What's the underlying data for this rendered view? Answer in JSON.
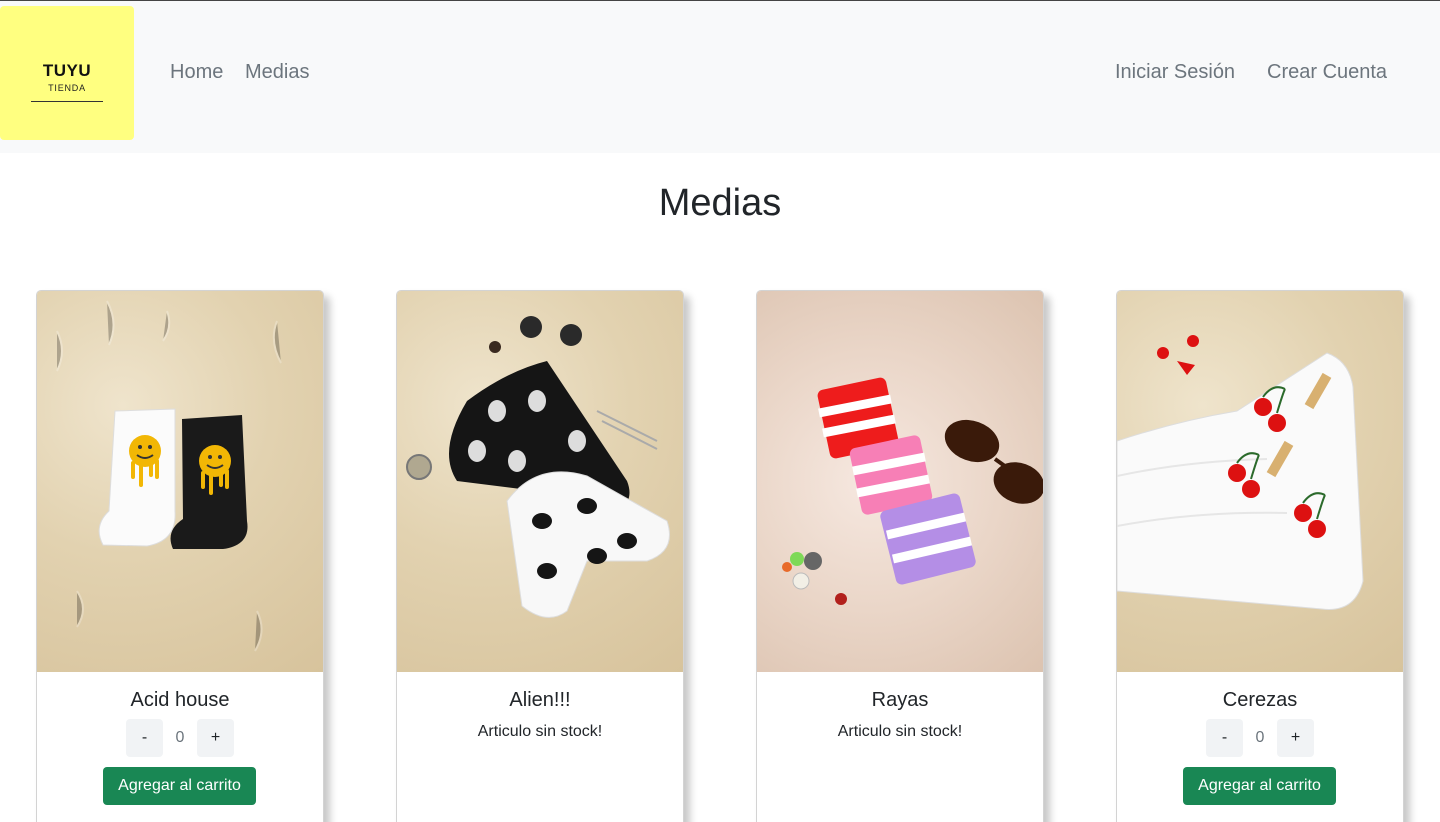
{
  "brand": {
    "name": "TUYU",
    "tagline": "TIENDA",
    "bg_color": "#ffff80"
  },
  "nav": {
    "left": [
      {
        "label": "Home"
      },
      {
        "label": "Medias"
      }
    ],
    "right": [
      {
        "label": "Iniciar Sesión"
      },
      {
        "label": "Crear Cuenta"
      }
    ]
  },
  "page": {
    "title": "Medias"
  },
  "colors": {
    "success": "#198754",
    "navbar_bg": "#f8f9fa",
    "muted": "#6c757d"
  },
  "products": [
    {
      "name": "Acid house",
      "in_stock": true,
      "quantity": "0",
      "minus_label": "-",
      "plus_label": "+",
      "add_label": "Agregar al carrito",
      "image": "white and black socks with melting smiley faces"
    },
    {
      "name": "Alien!!!",
      "in_stock": false,
      "stock_message": "Articulo sin stock!",
      "image": "black and white socks with alien heads"
    },
    {
      "name": "Rayas",
      "in_stock": false,
      "stock_message": "Articulo sin stock!",
      "image": "red, pink and purple striped socks with sunglasses"
    },
    {
      "name": "Cerezas",
      "in_stock": true,
      "quantity": "0",
      "minus_label": "-",
      "plus_label": "+",
      "add_label": "Agregar al carrito",
      "image": "white socks with embroidered cherries"
    }
  ]
}
